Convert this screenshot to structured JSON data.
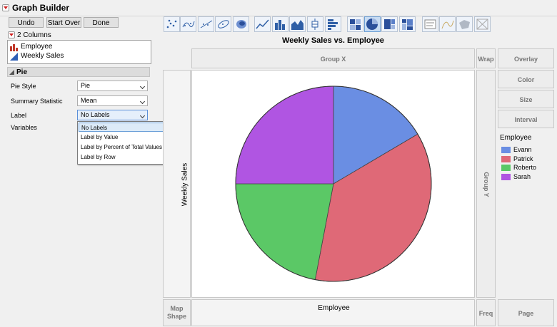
{
  "window": {
    "title": "Graph Builder"
  },
  "buttons": {
    "undo": "Undo",
    "start_over": "Start Over",
    "done": "Done"
  },
  "columns": {
    "header": "2 Columns",
    "items": [
      {
        "label": "Employee",
        "icon": "nominal-bar-icon"
      },
      {
        "label": "Weekly Sales",
        "icon": "continuous-triangle-icon"
      }
    ]
  },
  "section": {
    "title": "Pie"
  },
  "options": [
    {
      "label": "Pie Style",
      "value": "Pie"
    },
    {
      "label": "Summary Statistic",
      "value": "Mean"
    },
    {
      "label": "Label",
      "value": "No Labels"
    },
    {
      "label": "Variables"
    }
  ],
  "label_menu": {
    "items": [
      "No Labels",
      "Label by Value",
      "Label by Percent of Total Values",
      "Label by Row"
    ],
    "selected": "No Labels"
  },
  "toolbar": {
    "icons": [
      "points-icon",
      "smoother-icon",
      "line-of-fit-icon",
      "ellipse-icon",
      "contour-icon",
      "line-icon",
      "bar-icon",
      "area-icon",
      "box-plot-icon",
      "histogram-icon",
      "heatmap-icon",
      "pie-icon",
      "treemap-icon",
      "mosaic-icon",
      "caption-box-icon",
      "formula-icon",
      "map-shapes-icon",
      "custom-icon"
    ],
    "selected": "pie-icon"
  },
  "graph": {
    "title": "Weekly Sales vs. Employee",
    "x_label": "Employee",
    "y_label": "Weekly Sales"
  },
  "zones": {
    "group_x": "Group X",
    "group_y": "Group Y",
    "wrap": "Wrap",
    "overlay": "Overlay",
    "color": "Color",
    "size": "Size",
    "interval": "Interval",
    "map_shape": "Map Shape",
    "freq": "Freq",
    "page": "Page"
  },
  "legend": {
    "title": "Employee"
  },
  "colors": {
    "accent": "#d02020"
  },
  "chart_data": {
    "type": "pie",
    "title": "Weekly Sales vs. Employee",
    "categories": [
      "Evann",
      "Patrick",
      "Roberto",
      "Sarah"
    ],
    "values": [
      16.5,
      36.5,
      22,
      25
    ],
    "colors": [
      "#6a8ee3",
      "#df6977",
      "#5bc866",
      "#b055e2"
    ],
    "legend": "right"
  }
}
